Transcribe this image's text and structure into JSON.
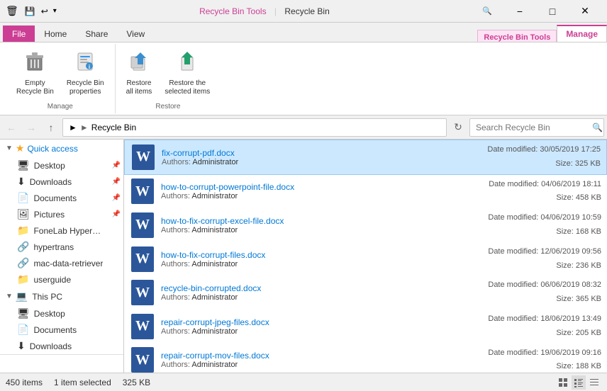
{
  "titleBar": {
    "title": "Recycle Bin",
    "minBtn": "−",
    "maxBtn": "□",
    "closeBtn": "✕"
  },
  "ribbonTabs": {
    "file": "File",
    "home": "Home",
    "share": "Share",
    "view": "View",
    "contextTitle": "Recycle Bin Tools",
    "manage": "Manage"
  },
  "ribbonButtons": {
    "emptyRecycleBin": "Empty\nRecycle Bin",
    "recycleBinProperties": "Recycle Bin\nproperties",
    "restoreAllItems": "Restore\nall items",
    "restoreSelectedItems": "Restore the\nselected items",
    "manageGroupLabel": "Manage",
    "restoreGroupLabel": "Restore"
  },
  "addressBar": {
    "path": "Recycle Bin",
    "searchPlaceholder": "Search Recycle Bin"
  },
  "sidebar": {
    "quickAccess": "Quick access",
    "items": [
      {
        "label": "Desktop",
        "icon": "📄",
        "pinned": true
      },
      {
        "label": "Downloads",
        "icon": "⬇",
        "pinned": true
      },
      {
        "label": "Documents",
        "icon": "📄",
        "pinned": true
      },
      {
        "label": "Pictures",
        "icon": "🖼",
        "pinned": true
      },
      {
        "label": "FoneLab HyperTrans...",
        "icon": "📁",
        "pinned": false
      },
      {
        "label": "hypertrans",
        "icon": "🔗",
        "pinned": false
      },
      {
        "label": "mac-data-retriever",
        "icon": "🔗",
        "pinned": false
      },
      {
        "label": "userguide",
        "icon": "📁",
        "pinned": false
      }
    ],
    "thisPC": "This PC",
    "pcItems": [
      {
        "label": "Desktop",
        "icon": "📄"
      },
      {
        "label": "Documents",
        "icon": "📄"
      },
      {
        "label": "Downloads",
        "icon": "⬇"
      }
    ]
  },
  "files": [
    {
      "name": "fix-corrupt-pdf.docx",
      "author": "Administrator",
      "dateModified": "Date modified: 30/05/2019 17:25",
      "size": "Size: 325 KB",
      "selected": true
    },
    {
      "name": "how-to-corrupt-powerpoint-file.docx",
      "author": "Administrator",
      "dateModified": "Date modified: 04/06/2019 18:11",
      "size": "Size: 458 KB",
      "selected": false
    },
    {
      "name": "how-to-fix-corrupt-excel-file.docx",
      "author": "Administrator",
      "dateModified": "Date modified: 04/06/2019 10:59",
      "size": "Size: 168 KB",
      "selected": false
    },
    {
      "name": "how-to-fix-corrupt-files.docx",
      "author": "Administrator",
      "dateModified": "Date modified: 12/06/2019 09:56",
      "size": "Size: 236 KB",
      "selected": false
    },
    {
      "name": "recycle-bin-corrupted.docx",
      "author": "Administrator",
      "dateModified": "Date modified: 06/06/2019 08:32",
      "size": "Size: 365 KB",
      "selected": false
    },
    {
      "name": "repair-corrupt-jpeg-files.docx",
      "author": "Administrator",
      "dateModified": "Date modified: 18/06/2019 13:49",
      "size": "Size: 205 KB",
      "selected": false
    },
    {
      "name": "repair-corrupt-mov-files.docx",
      "author": "Administrator",
      "dateModified": "Date modified: 19/06/2019 09:16",
      "size": "Size: 188 KB",
      "selected": false
    }
  ],
  "statusBar": {
    "itemCount": "450 items",
    "selected": "1 item selected",
    "size": "325 KB"
  }
}
